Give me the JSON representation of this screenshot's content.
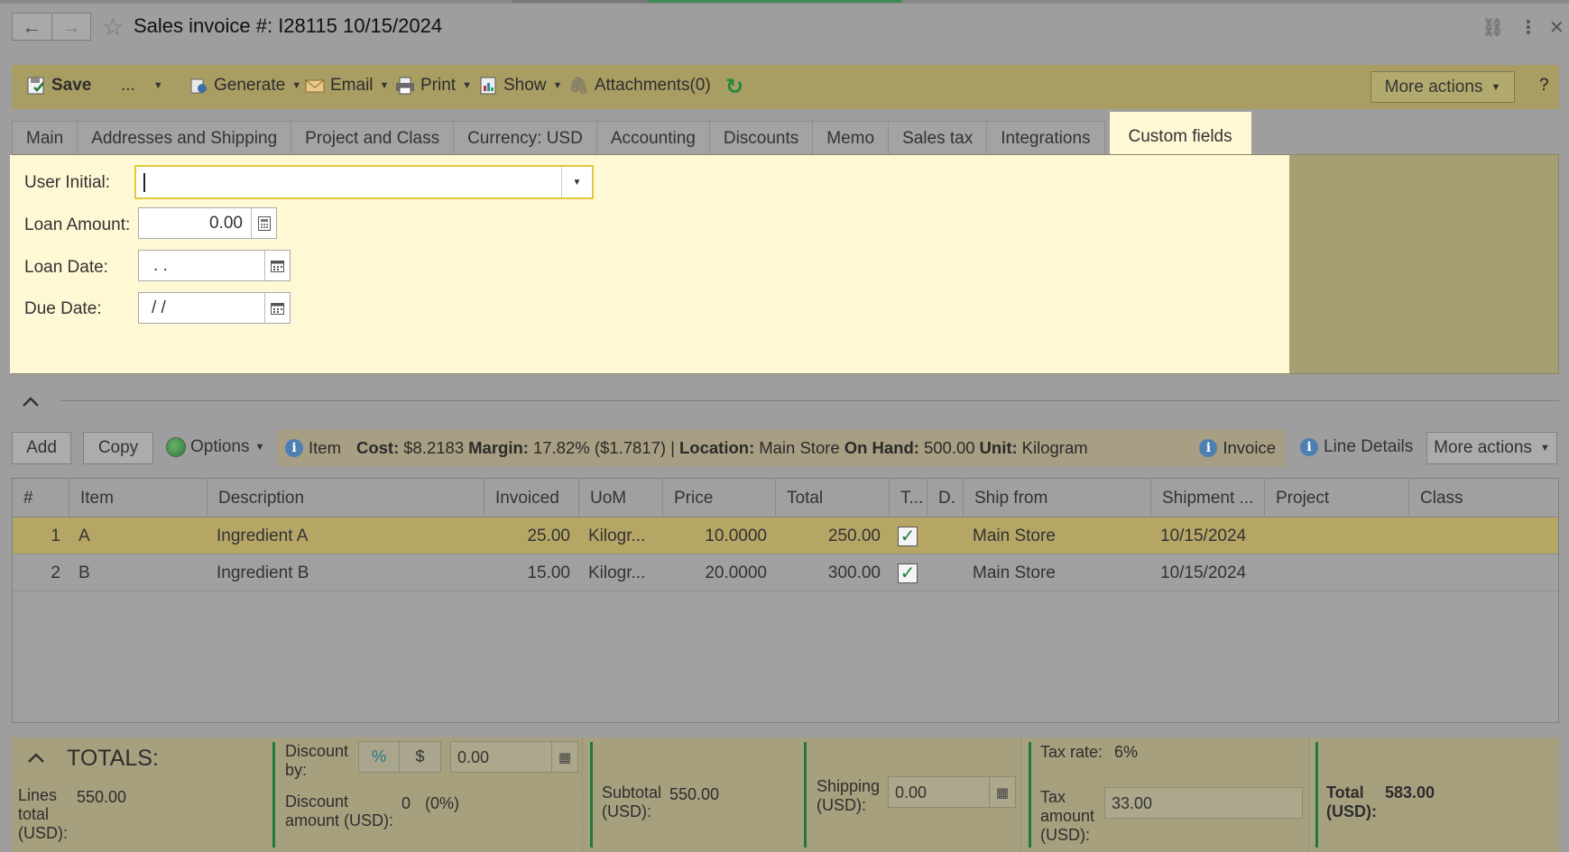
{
  "header": {
    "title": "Sales invoice #: I28115 10/15/2024"
  },
  "toolbar": {
    "save": "Save",
    "ellipsis": "...",
    "generate": "Generate",
    "email": "Email",
    "print": "Print",
    "show": "Show",
    "attachments": "Attachments(0)",
    "more_actions": "More actions",
    "help": "?"
  },
  "tabs": [
    "Main",
    "Addresses and Shipping",
    "Project and Class",
    "Currency: USD",
    "Accounting",
    "Discounts",
    "Memo",
    "Sales tax",
    "Integrations",
    "Custom fields"
  ],
  "custom_fields": {
    "user_initial_label": "User Initial:",
    "user_initial_value": "",
    "loan_amount_label": "Loan Amount:",
    "loan_amount_value": "0.00",
    "loan_date_label": "Loan Date:",
    "loan_date_value": ". .",
    "due_date_label": "Due Date:",
    "due_date_value": "/ /"
  },
  "grid_toolbar": {
    "add": "Add",
    "copy": "Copy",
    "options": "Options",
    "info_item": "Item",
    "cost_label": "Cost:",
    "cost_value": "$8.2183",
    "margin_label": "Margin:",
    "margin_value": "17.82% ($1.7817) |",
    "location_label": "Location:",
    "location_value": "Main Store",
    "onhand_label": "On Hand:",
    "onhand_value": "500.00",
    "unit_label": "Unit:",
    "unit_value": "Kilogram",
    "invoice": "Invoice",
    "line_details": "Line Details",
    "more_actions": "More actions"
  },
  "table": {
    "columns": [
      "#",
      "Item",
      "Description",
      "Invoiced",
      "UoM",
      "Price",
      "Total",
      "T...",
      "D.",
      "Ship from",
      "Shipment ...",
      "Project",
      "Class"
    ],
    "rows": [
      {
        "num": "1",
        "item": "A",
        "description": "Ingredient A",
        "invoiced": "25.00",
        "uom": "Kilogr...",
        "price": "10.0000",
        "total": "250.00",
        "taxable": true,
        "ship_from": "Main Store",
        "shipment": "10/15/2024",
        "project": "",
        "class": ""
      },
      {
        "num": "2",
        "item": "B",
        "description": "Ingredient B",
        "invoiced": "15.00",
        "uom": "Kilogr...",
        "price": "20.0000",
        "total": "300.00",
        "taxable": true,
        "ship_from": "Main Store",
        "shipment": "10/15/2024",
        "project": "",
        "class": ""
      }
    ]
  },
  "totals": {
    "heading": "TOTALS:",
    "lines_total_label": "Lines total (USD):",
    "lines_total_value": "550.00",
    "discount_by_label": "Discount by:",
    "discount_pct": "%",
    "discount_dollar": "$",
    "discount_input": "0.00",
    "discount_amount_label": "Discount amount (USD):",
    "discount_amount_value": "0",
    "discount_amount_pct": "(0%)",
    "subtotal_label": "Subtotal (USD):",
    "subtotal_value": "550.00",
    "shipping_label": "Shipping (USD):",
    "shipping_value": "0.00",
    "tax_rate_label": "Tax rate:",
    "tax_rate_value": "6%",
    "tax_amount_label": "Tax amount (USD):",
    "tax_amount_value": "33.00",
    "total_label": "Total (USD):",
    "total_value": "583.00"
  },
  "colors": {
    "accent_green": "#1f7a3a",
    "panel_yellow": "#fff8d4",
    "focus_yellow": "#e0c93c"
  }
}
